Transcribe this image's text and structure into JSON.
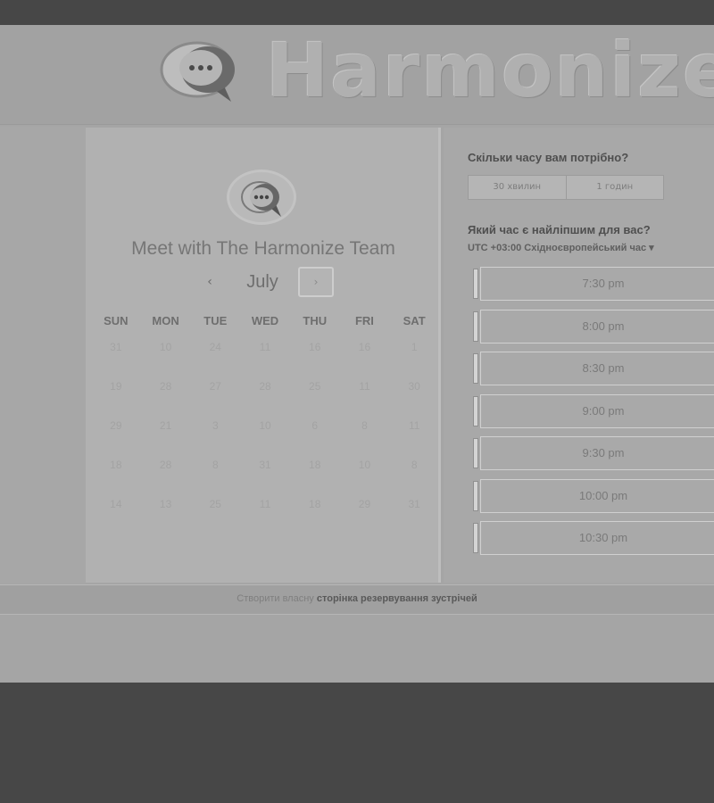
{
  "header": {
    "brand": "Harmonize"
  },
  "booking": {
    "title": "Meet with The Harmonize Team",
    "month": "July",
    "prev_icon": "‹",
    "next_icon": "›",
    "weekdays": [
      "SUN",
      "MON",
      "TUE",
      "WED",
      "THU",
      "FRI",
      "SAT"
    ],
    "weeks": [
      [
        "31",
        "10",
        "24",
        "11",
        "16",
        "16",
        "1"
      ],
      [
        "19",
        "28",
        "27",
        "28",
        "25",
        "11",
        "30"
      ],
      [
        "29",
        "21",
        "3",
        "10",
        "6",
        "8",
        "11"
      ],
      [
        "18",
        "28",
        "8",
        "31",
        "18",
        "10",
        "8"
      ],
      [
        "14",
        "13",
        "25",
        "11",
        "18",
        "29",
        "31"
      ]
    ]
  },
  "schedule": {
    "duration_question": "Скільки часу вам потрібно?",
    "durations": [
      "30 хвилин",
      "1 годин"
    ],
    "time_question": "Який час є найліпшим для вас?",
    "timezone": "UTC +03:00 Східноєвропейський час ▾",
    "slots": [
      "7:30 pm",
      "8:00 pm",
      "8:30 pm",
      "9:00 pm",
      "9:30 pm",
      "10:00 pm",
      "10:30 pm"
    ]
  },
  "footer": {
    "text_plain": "Створити власну ",
    "text_bold": "сторінка резервування зустрічей"
  },
  "colors": {
    "background": "#474747",
    "panel": "#b1b1b1",
    "accent": "#d4d4d4"
  }
}
